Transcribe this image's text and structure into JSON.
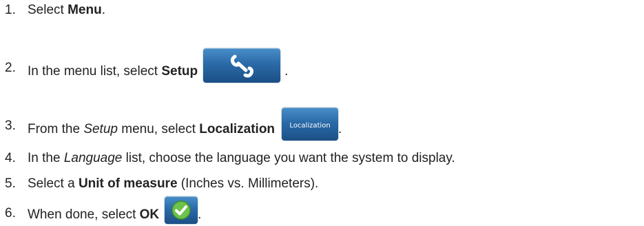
{
  "steps": [
    {
      "num": "1.",
      "pre": "Select ",
      "bold": "Menu",
      "post": "."
    },
    {
      "num": "2.",
      "pre": "In the menu list, select ",
      "bold": "Setup",
      "post": "."
    },
    {
      "num": "3.",
      "pre": "From the ",
      "italic": "Setup",
      "mid": " menu, select ",
      "bold": "Localization",
      "post": ".",
      "button_label": "Localization"
    },
    {
      "num": "4.",
      "pre": "In the ",
      "italic": "Language",
      "post": " list, choose the language you want the system to display."
    },
    {
      "num": "5.",
      "pre": "Select a ",
      "bold": "Unit of measure",
      "post": " (Inches vs. Millimeters)."
    },
    {
      "num": "6.",
      "pre": "When done, select ",
      "bold": "OK",
      "post": "."
    }
  ],
  "icons": {
    "setup": "wrench-icon",
    "ok": "checkmark-icon"
  },
  "colors": {
    "button_blue": "#2a6aa8",
    "ok_green": "#6cc24a"
  }
}
